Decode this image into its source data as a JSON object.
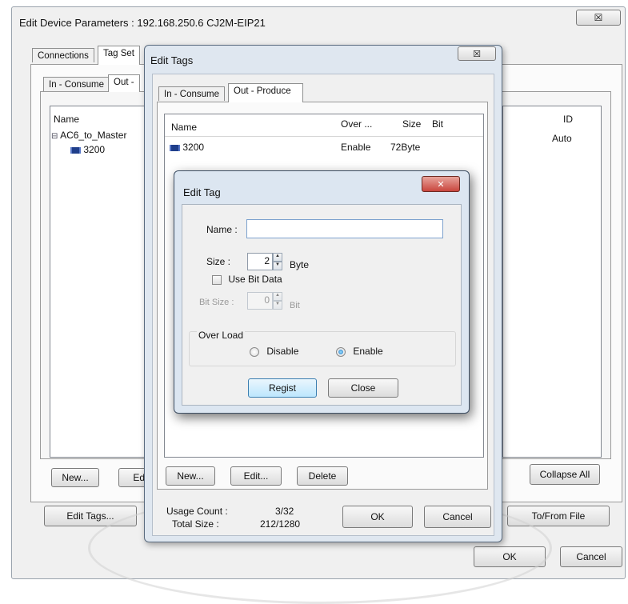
{
  "outer": {
    "title": "Edit Device Parameters : 192.168.250.6 CJ2M-EIP21",
    "close_glyph": "☒",
    "tabs": [
      "Connections",
      "Tag Set"
    ],
    "subtabs": [
      "In - Consume",
      "Out -"
    ],
    "tree_header": "Name",
    "tree_items": [
      "AC6_to_Master",
      "3200"
    ],
    "id_header": "ID",
    "id_value": "Auto",
    "btn_new": "New...",
    "btn_edit_partial": "Ed",
    "btn_collapse_all": "Collapse All",
    "btn_edit_tags": "Edit Tags...",
    "btn_to_from_file": "To/From File",
    "btn_ok": "OK",
    "btn_cancel": "Cancel"
  },
  "edit_tags": {
    "title": "Edit Tags",
    "close_glyph": "☒",
    "tabs": [
      "In - Consume",
      "Out - Produce"
    ],
    "columns": [
      "Name",
      "Over ...",
      "Size",
      "Bit"
    ],
    "rows": [
      {
        "name": "3200",
        "over": "Enable",
        "size": "72Byte",
        "bit": ""
      }
    ],
    "btn_new": "New...",
    "btn_edit": "Edit...",
    "btn_delete": "Delete",
    "usage_count_label": "Usage Count :",
    "usage_count_value": "3/32",
    "total_size_label": "Total Size :",
    "total_size_value": "212/1280",
    "btn_ok": "OK",
    "btn_cancel": "Cancel"
  },
  "edit_tag": {
    "title": "Edit Tag",
    "close_glyph": "✕",
    "name_label": "Name :",
    "name_value": "",
    "size_label": "Size :",
    "size_value": "2",
    "size_unit": "Byte",
    "use_bit_data_label": "Use Bit Data",
    "use_bit_data_checked": false,
    "bit_size_label": "Bit Size :",
    "bit_size_value": "0",
    "bit_size_unit": "Bit",
    "overload_group_label": "Over Load",
    "overload_options": [
      "Disable",
      "Enable"
    ],
    "overload_selected": "Enable",
    "btn_regist": "Regist",
    "btn_close": "Close"
  },
  "colors": {
    "window_bg": "#f0f0f0",
    "dialog_frame": "#dfe7f0",
    "close_red": "#c9463d",
    "selection_accent": "#3c7fb1"
  }
}
